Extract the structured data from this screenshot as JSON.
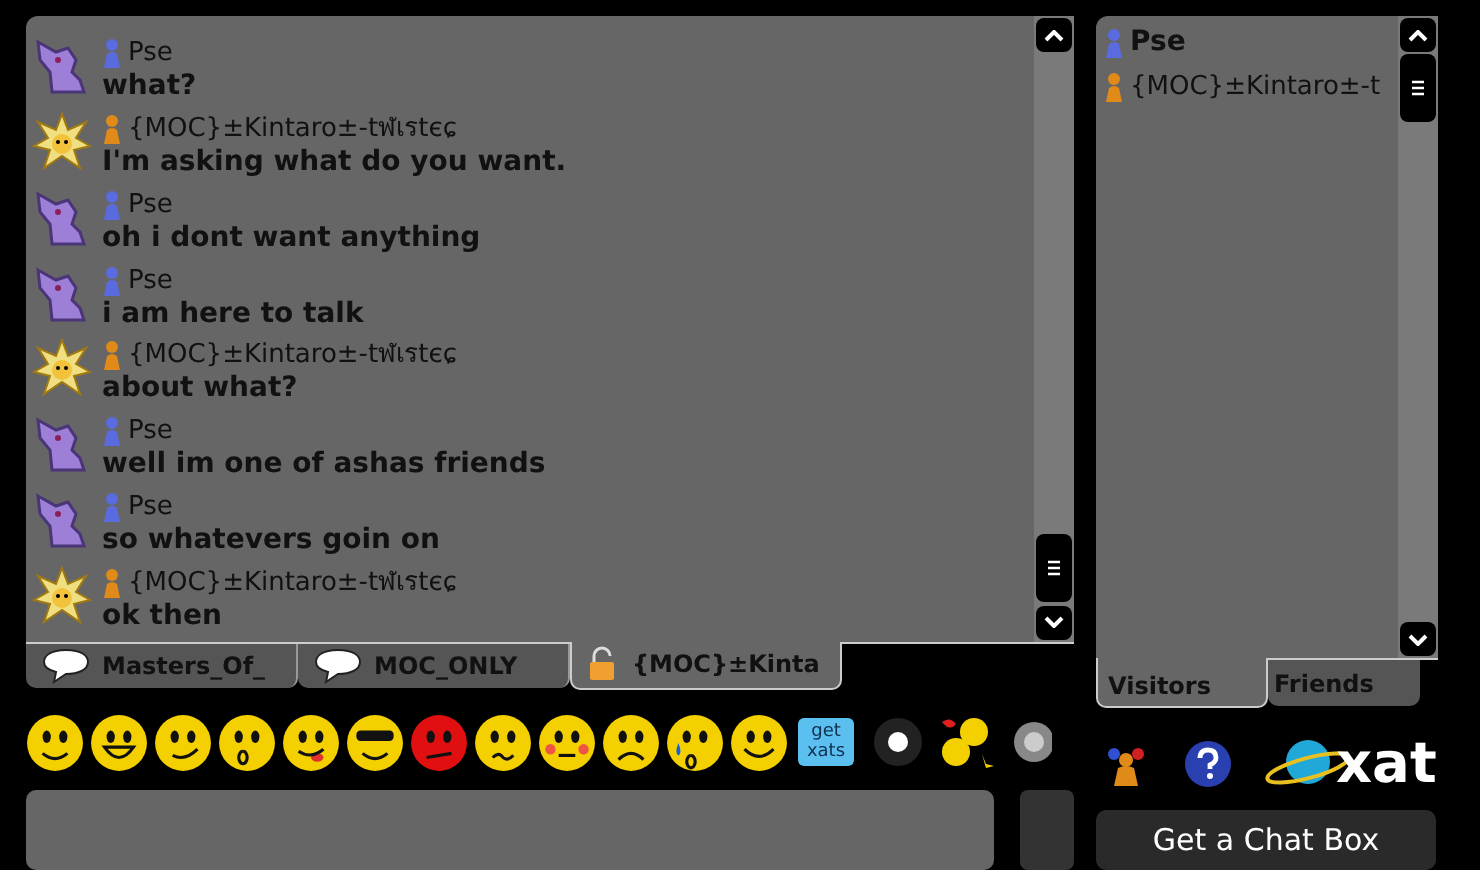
{
  "messages": [
    {
      "user": "Pse",
      "kind": "cat",
      "color": "#5a6be0",
      "text": "what?"
    },
    {
      "user": "{MOC}±Kintaro±-tฬเรtєɕ",
      "kind": "star",
      "color": "#e08a1a",
      "text": "I'm asking what do you want."
    },
    {
      "user": "Pse",
      "kind": "cat",
      "color": "#5a6be0",
      "text": "oh i dont want anything"
    },
    {
      "user": "Pse",
      "kind": "cat",
      "color": "#5a6be0",
      "text": "i am here to talk"
    },
    {
      "user": "{MOC}±Kintaro±-tฬเรtєɕ",
      "kind": "star",
      "color": "#e08a1a",
      "text": "about what?"
    },
    {
      "user": "Pse",
      "kind": "cat",
      "color": "#5a6be0",
      "text": "well im one of ashas friends"
    },
    {
      "user": "Pse",
      "kind": "cat",
      "color": "#5a6be0",
      "text": "so whatevers goin on"
    },
    {
      "user": "{MOC}±Kintaro±-tฬเรtєɕ",
      "kind": "star",
      "color": "#e08a1a",
      "text": "ok then"
    }
  ],
  "chat_tabs": [
    {
      "label": "Masters_Of_",
      "kind": "bubble",
      "selected": false
    },
    {
      "label": "MOC_ONLY",
      "kind": "bubble",
      "selected": false
    },
    {
      "label": "{MOC}±Kinta",
      "kind": "lock",
      "selected": true
    }
  ],
  "get_xats": "get xats",
  "visitors": [
    {
      "name": "Pse",
      "color": "#5a6be0",
      "bold": true
    },
    {
      "name": "{MOC}±Kintaro±-t",
      "color": "#e08a1a",
      "bold": false
    }
  ],
  "list_tabs": [
    {
      "label": "Visitors",
      "selected": true
    },
    {
      "label": "Friends",
      "selected": false
    }
  ],
  "logo": "xat",
  "chat_box_button": "Get a Chat Box"
}
